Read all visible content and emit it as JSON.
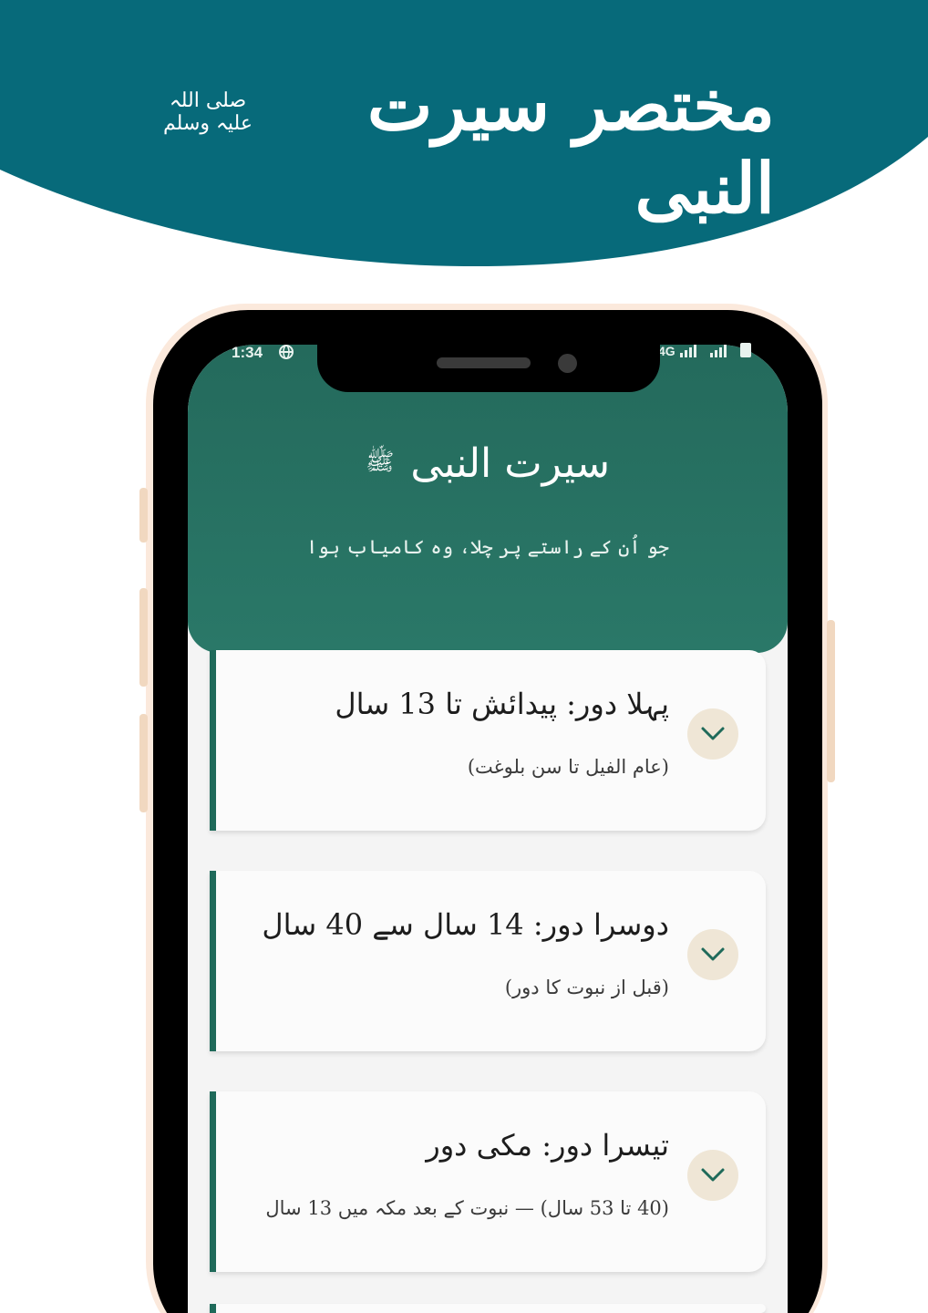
{
  "banner": {
    "title": "مختصر سیرت النبی",
    "honorific": "صلی اللہ علیہ وسلم",
    "color": "#076a7a"
  },
  "status_bar": {
    "time": "1:34",
    "left_icon": "vpn-globe-icon",
    "network": "4G",
    "right_icons": [
      "signal-icon",
      "signal-icon",
      "battery-icon"
    ]
  },
  "app": {
    "title": "سیرت النبی",
    "title_honorific": "ﷺ",
    "subtitle": "جو اُن کے راستے پر چلا، وہ کامیاب ہوا",
    "header_color": "#246a5c"
  },
  "periods": [
    {
      "title": "پہلا دور: پیدائش تا 13 سال",
      "subtitle": "(عام الفیل تا سن بلوغت)",
      "icon": "chevron-down-icon"
    },
    {
      "title": "دوسرا دور: 14 سال سے 40 سال",
      "subtitle": "(قبل از نبوت کا دور)",
      "icon": "chevron-down-icon"
    },
    {
      "title": "تیسرا دور: مکی دور",
      "subtitle": "(40 تا 53 سال) — نبوت کے بعد مکہ میں 13 سال",
      "icon": "chevron-down-icon"
    }
  ]
}
